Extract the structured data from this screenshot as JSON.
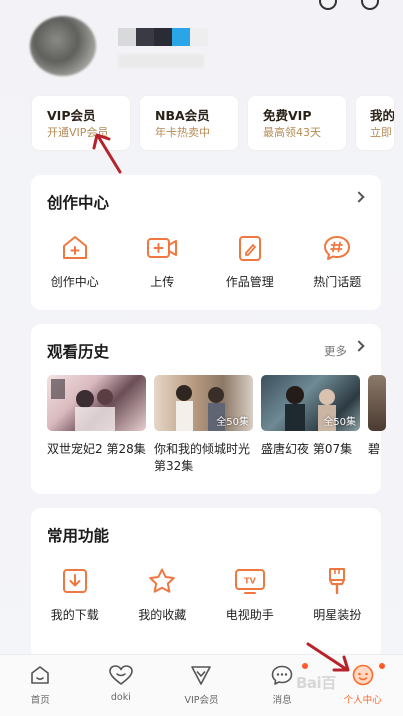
{
  "vip_cards": [
    {
      "title": "VIP会员",
      "sub": "开通VIP会员"
    },
    {
      "title": "NBA会员",
      "sub": "年卡热卖中"
    },
    {
      "title": "免费VIP",
      "sub": "最高领43天"
    },
    {
      "title": "我的",
      "sub": "立即"
    }
  ],
  "creation": {
    "title": "创作中心",
    "items": [
      {
        "label": "创作中心",
        "icon": "create-center-icon"
      },
      {
        "label": "上传",
        "icon": "upload-video-icon"
      },
      {
        "label": "作品管理",
        "icon": "works-manage-icon"
      },
      {
        "label": "热门话题",
        "icon": "hot-topic-icon"
      }
    ]
  },
  "history": {
    "title": "观看历史",
    "more": "更多",
    "items": [
      {
        "title": "双世宠妃2 第28集",
        "badge": ""
      },
      {
        "title": "你和我的倾城时光 第32集",
        "badge": "全50集"
      },
      {
        "title": "盛唐幻夜 第07集",
        "badge": "全50集"
      },
      {
        "title": "碧",
        "badge": ""
      }
    ]
  },
  "functions": {
    "title": "常用功能",
    "items": [
      {
        "label": "我的下载",
        "icon": "download-icon"
      },
      {
        "label": "我的收藏",
        "icon": "star-icon"
      },
      {
        "label": "电视助手",
        "icon": "tv-icon"
      },
      {
        "label": "明星装扮",
        "icon": "brush-icon"
      }
    ]
  },
  "tabs": [
    {
      "label": "首页",
      "icon": "home-icon"
    },
    {
      "label": "doki",
      "icon": "doki-heart-icon"
    },
    {
      "label": "VIP会员",
      "icon": "vip-diamond-icon"
    },
    {
      "label": "消息",
      "icon": "message-icon"
    },
    {
      "label": "个人中心",
      "icon": "profile-icon"
    }
  ],
  "colors": {
    "accent": "#ff6a2c",
    "icon_orange": "#f07840",
    "vip_gold": "#b58b56"
  },
  "watermark": "Bai百"
}
